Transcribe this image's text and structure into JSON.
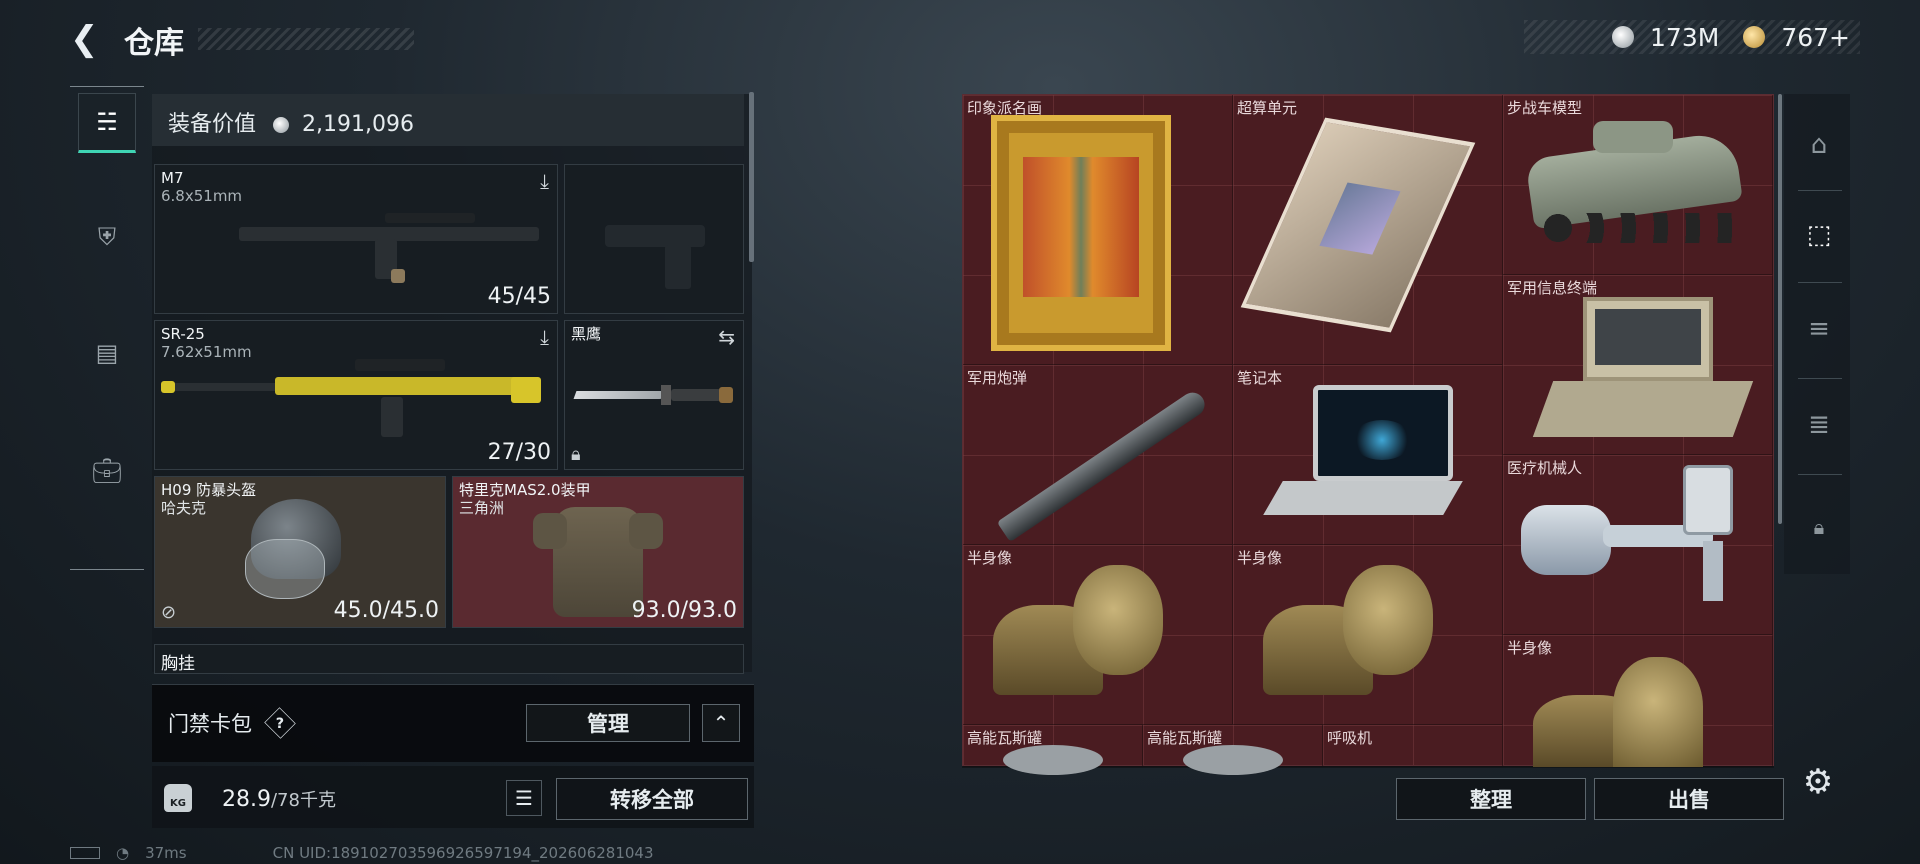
{
  "header": {
    "title": "仓库",
    "silver_amount": "173M",
    "gold_amount": "767+"
  },
  "left_nav": {
    "tabs": [
      {
        "icon": "pistol-icon",
        "active": true
      },
      {
        "icon": "armor-icon",
        "active": false
      },
      {
        "icon": "backpack-icon",
        "active": false
      },
      {
        "icon": "briefcase-icon",
        "active": false
      }
    ]
  },
  "equipment": {
    "value_label": "装备价值",
    "value": "2,191,096",
    "primary_weapon": {
      "name": "M7",
      "caliber": "6.8x51mm",
      "ammo": "45/45"
    },
    "secondary_weapon": {
      "name": "SR-25",
      "caliber": "7.62x51mm",
      "ammo": "27/30"
    },
    "melee": {
      "name": "黑鹰"
    },
    "helmet": {
      "name": "H09 防暴头盔",
      "brand": "哈夫克",
      "durability": "45.0/45.0"
    },
    "armor": {
      "name": "特里克MAS2.0装甲",
      "brand": "三角洲",
      "durability": "93.0/93.0"
    },
    "chest_rig_partial": "胸挂"
  },
  "card_bag": {
    "label": "门禁卡包",
    "help": "?",
    "manage_label": "管理"
  },
  "weight": {
    "current": "28.9",
    "max": "/78千克",
    "kg_badge": "KG"
  },
  "transfer_all_label": "转移全部",
  "status_bar": {
    "ping": "37ms",
    "uid": "CN UID:18910270359692659​7194_202606281043"
  },
  "warehouse": {
    "items": [
      {
        "label": "印象派名画"
      },
      {
        "label": "超算单元"
      },
      {
        "label": "步战车模型"
      },
      {
        "label": "军用信息终端"
      },
      {
        "label": "军用炮弹"
      },
      {
        "label": "笔记本"
      },
      {
        "label": "医疗机械人"
      },
      {
        "label": "半身像"
      },
      {
        "label": "半身像"
      },
      {
        "label": "半身像"
      },
      {
        "label": "高能瓦斯罐"
      },
      {
        "label": "高能瓦斯罐"
      },
      {
        "label": "呼吸机"
      }
    ],
    "sort_label": "整理",
    "sell_label": "出售"
  },
  "colors": {
    "accent": "#3fd5b4",
    "item_bg": "#4a1c21",
    "gold_frame": "#c99a2e"
  }
}
